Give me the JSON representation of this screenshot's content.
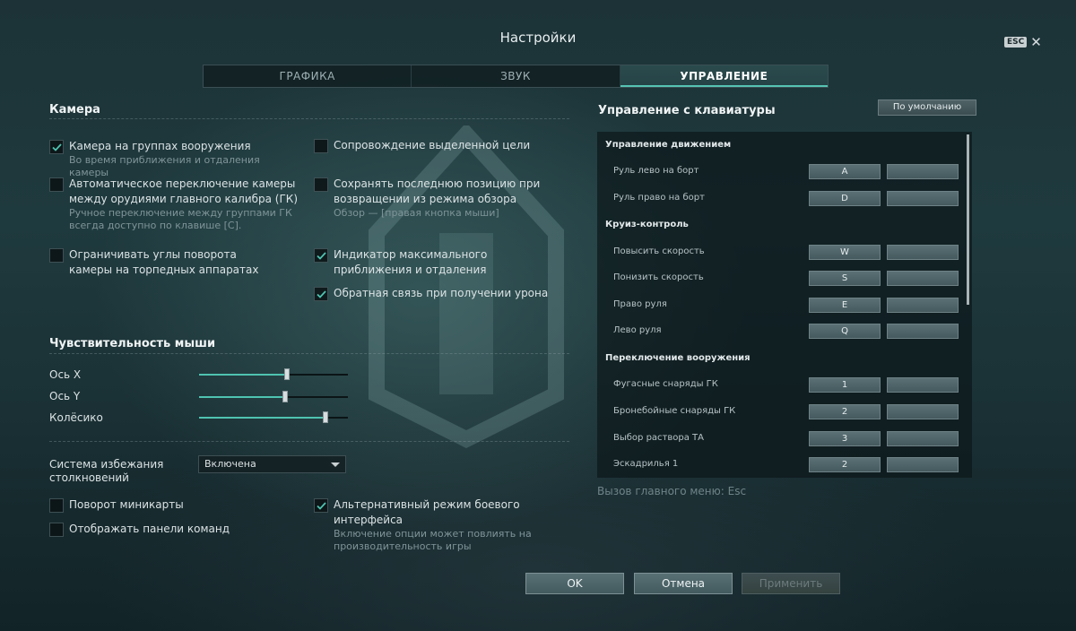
{
  "window": {
    "title": "Настройки",
    "esc_label": "ESC",
    "close_glyph": "✕"
  },
  "tabs": [
    {
      "label": "ГРАФИКА",
      "active": false
    },
    {
      "label": "ЗВУК",
      "active": false
    },
    {
      "label": "УПРАВЛЕНИЕ",
      "active": true
    }
  ],
  "camera": {
    "title": "Камера",
    "left_options": [
      {
        "label": "Камера на группах вооружения",
        "sub": "Во время приближения и отдаления камеры",
        "checked": true
      },
      {
        "label": "Автоматическое переключение камеры между орудиями главного калибра (ГК)",
        "sub": "Ручное переключение между группами ГК всегда доступно по клавише [C].",
        "checked": false
      },
      {
        "label": "Ограничивать углы поворота камеры на торпедных аппаратах",
        "sub": "",
        "checked": false
      }
    ],
    "right_options": [
      {
        "label": "Сопровождение выделенной цели",
        "sub": "",
        "checked": false
      },
      {
        "label": "Сохранять последнюю позицию при возвращении из режима обзора",
        "sub": "Обзор — [правая кнопка мыши]",
        "checked": false
      },
      {
        "label": "Индикатор максимального приближения и отдаления",
        "sub": "",
        "checked": true
      },
      {
        "label": "Обратная связь при получении урона",
        "sub": "",
        "checked": true
      }
    ]
  },
  "mouse": {
    "title": "Чувствительность мыши",
    "sliders": [
      {
        "label": "Ось X",
        "value": 0.59
      },
      {
        "label": "Ось Y",
        "value": 0.58
      },
      {
        "label": "Колёсико",
        "value": 0.85
      }
    ]
  },
  "collision": {
    "label": "Система избежания столкновений",
    "value": "Включена"
  },
  "misc": {
    "left_options": [
      {
        "label": "Поворот миникарты",
        "sub": "",
        "checked": false
      },
      {
        "label": "Отображать панели команд",
        "sub": "",
        "checked": false
      }
    ],
    "right_options": [
      {
        "label": "Альтернативный режим боевого интерфейса",
        "sub": "Включение опции может повлиять на производительность игры",
        "checked": true
      }
    ]
  },
  "keyboard": {
    "title": "Управление с клавиатуры",
    "default_button": "По умолчанию",
    "groups": [
      {
        "title": "Управление движением",
        "rows": [
          {
            "label": "Руль лево на борт",
            "key1": "A",
            "key2": ""
          },
          {
            "label": "Руль право на борт",
            "key1": "D",
            "key2": ""
          }
        ]
      },
      {
        "title": "Круиз-контроль",
        "rows": [
          {
            "label": "Повысить скорость",
            "key1": "W",
            "key2": ""
          },
          {
            "label": "Понизить скорость",
            "key1": "S",
            "key2": ""
          },
          {
            "label": "Право руля",
            "key1": "E",
            "key2": ""
          },
          {
            "label": "Лево руля",
            "key1": "Q",
            "key2": ""
          }
        ]
      },
      {
        "title": "Переключение вооружения",
        "rows": [
          {
            "label": "Фугасные снаряды ГК",
            "key1": "1",
            "key2": ""
          },
          {
            "label": "Бронебойные снаряды ГК",
            "key1": "2",
            "key2": ""
          },
          {
            "label": "Выбор раствора ТА",
            "key1": "3",
            "key2": ""
          },
          {
            "label": "Эскадрилья 1",
            "key1": "2",
            "key2": ""
          }
        ]
      }
    ],
    "hint": "Вызов главного меню: Esc"
  },
  "footer": {
    "ok": "OK",
    "cancel": "Отмена",
    "apply": "Применить"
  },
  "colors": {
    "accent": "#4fc3b1",
    "panel": "#0c181b"
  }
}
